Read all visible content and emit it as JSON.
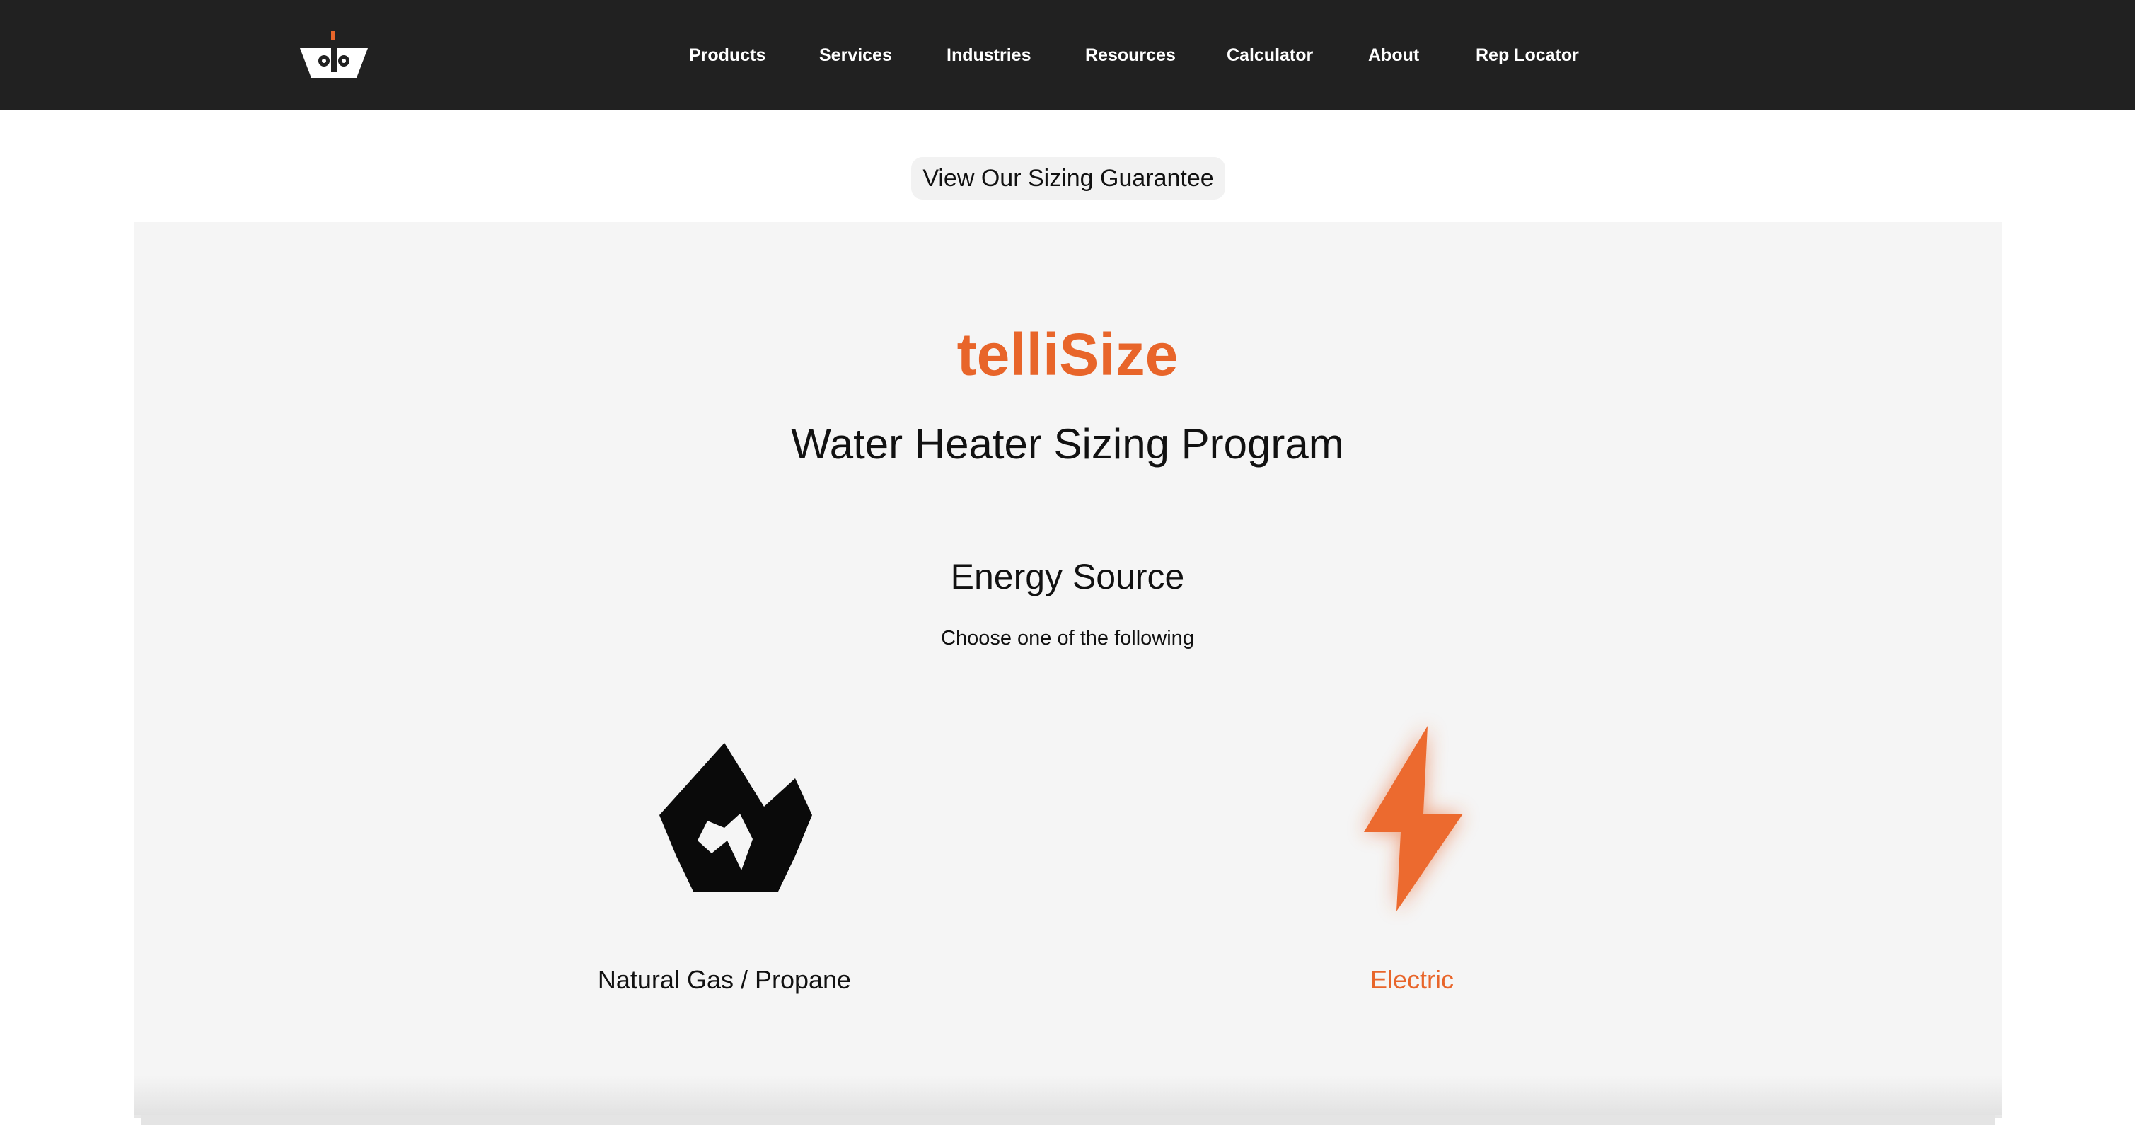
{
  "header": {
    "logo_icon": "company-logo-icon",
    "nav": [
      {
        "label": "Products"
      },
      {
        "label": "Services"
      },
      {
        "label": "Industries"
      },
      {
        "label": "Resources"
      },
      {
        "label": "Calculator"
      },
      {
        "label": "About"
      },
      {
        "label": "Rep Locator"
      }
    ]
  },
  "guarantee_button": {
    "label": "View Our Sizing Guarantee"
  },
  "main": {
    "brand": "telliSize",
    "title": "Water Heater Sizing Program",
    "section_title": "Energy Source",
    "section_subtitle": "Choose one of the following",
    "options": [
      {
        "label": "Natural Gas / Propane",
        "icon": "flame-icon",
        "selected": false
      },
      {
        "label": "Electric",
        "icon": "lightning-bolt-icon",
        "selected": true
      }
    ]
  },
  "colors": {
    "accent": "#e8652a",
    "header_bg": "#212121",
    "panel_bg": "#f5f5f5"
  }
}
